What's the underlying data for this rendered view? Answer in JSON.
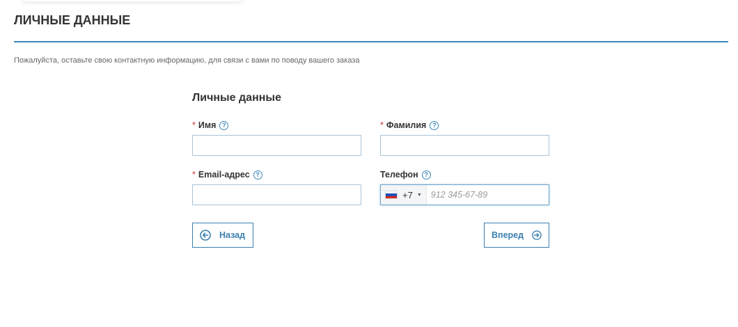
{
  "page": {
    "title": "ЛИЧНЫЕ ДАННЫЕ",
    "intro": "Пожалуйста, оставьте свою контактную информацию, для связи с вами по поводу вашего заказа",
    "accent_color": "#3a87b8"
  },
  "form": {
    "heading": "Личные данные",
    "required_marker": "*",
    "help_icon_glyph": "?",
    "fields": {
      "first_name": {
        "label": "Имя",
        "value": "",
        "required": true
      },
      "last_name": {
        "label": "Фамилия",
        "value": "",
        "required": true
      },
      "email": {
        "label": "Email-адрес",
        "value": "",
        "required": true
      },
      "phone": {
        "label": "Телефон",
        "required": false,
        "country_flag": "russia-flag-icon",
        "dial_code": "+7",
        "placeholder": "912 345-67-89",
        "value": ""
      }
    },
    "buttons": {
      "back": {
        "label": "Назад",
        "icon": "arrow-left-circle-icon"
      },
      "next": {
        "label": "Вперед",
        "icon": "arrow-right-circle-icon"
      }
    }
  }
}
